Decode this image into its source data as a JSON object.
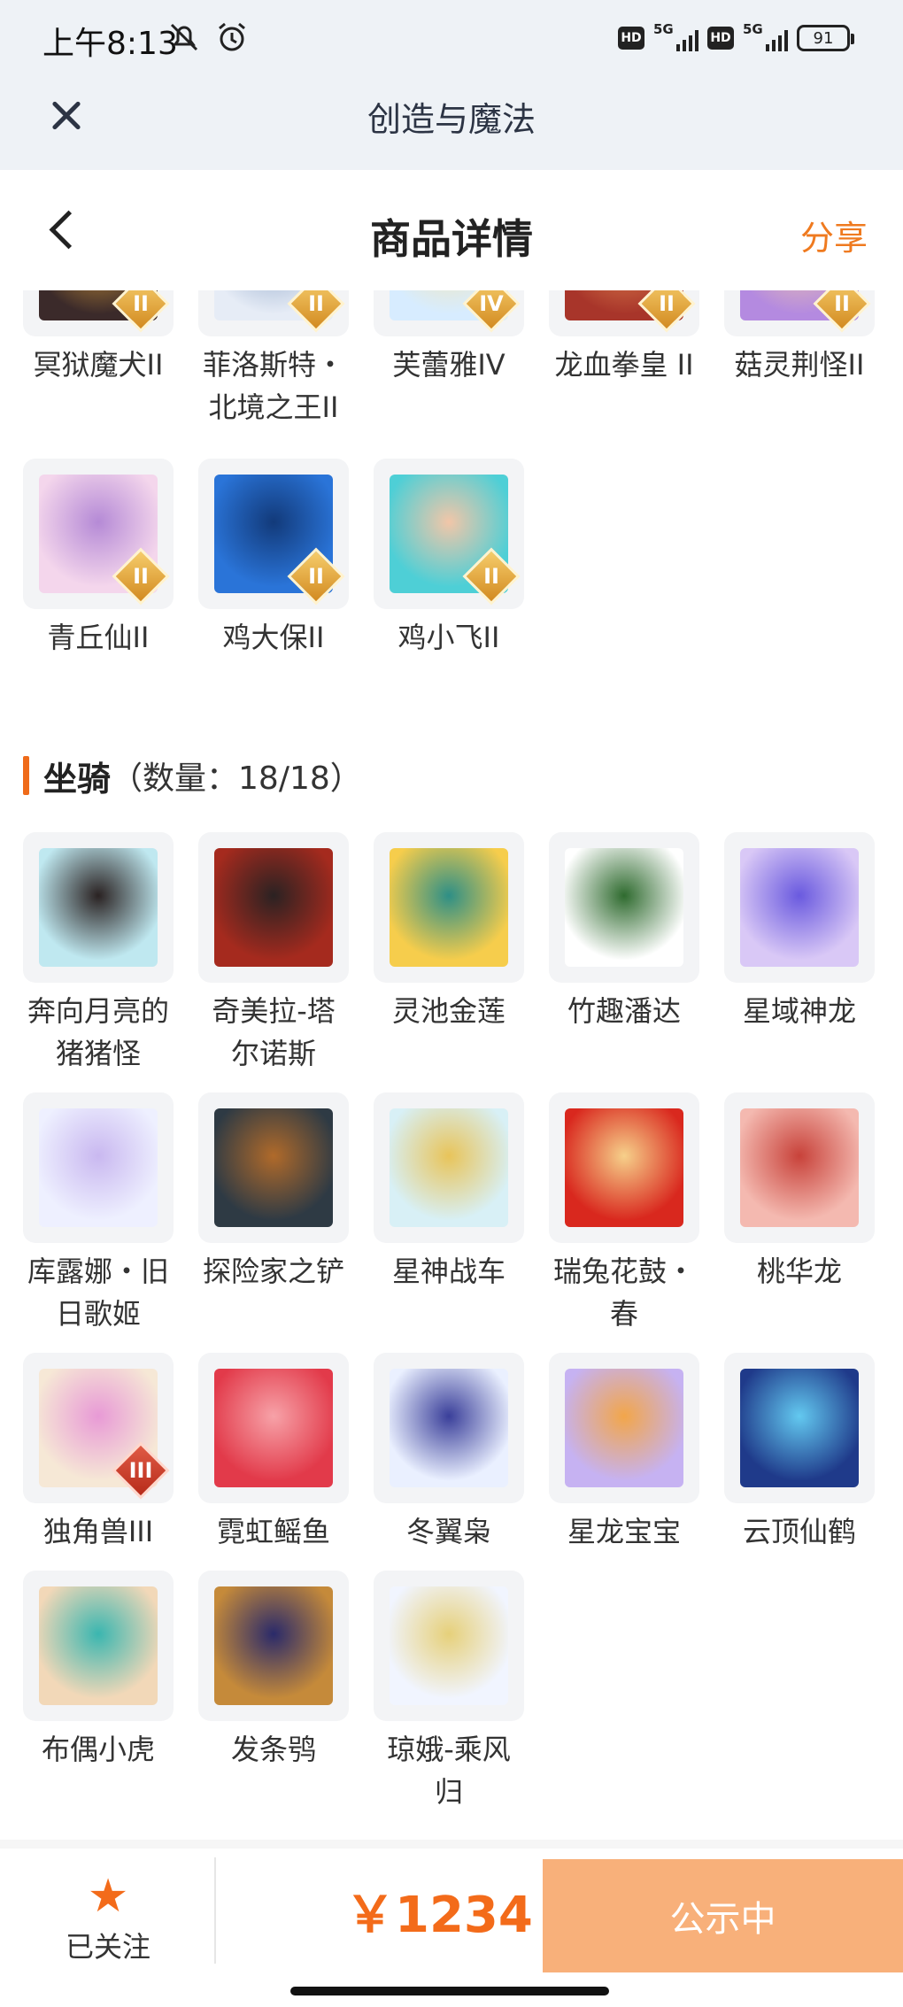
{
  "status_bar": {
    "time": "上午8:13",
    "network1": "5G",
    "network2": "5G",
    "battery": "91"
  },
  "app_bar": {
    "title": "创造与魔法"
  },
  "header": {
    "title": "商品详情",
    "share": "分享"
  },
  "pets_grid": [
    {
      "name": "冥狱魔犬II",
      "tier": "II",
      "colors": [
        "#3b2a2a",
        "#d39a3a"
      ]
    },
    {
      "name": "菲洛斯特・北境之王II",
      "tier": "II",
      "colors": [
        "#e6ecf6",
        "#8fa6c8"
      ]
    },
    {
      "name": "芙蕾雅IV",
      "tier": "IV",
      "colors": [
        "#d7ecff",
        "#f6e6b0"
      ]
    },
    {
      "name": "龙血拳皇 II",
      "tier": "II",
      "colors": [
        "#a8352a",
        "#e38a52"
      ]
    },
    {
      "name": "菇灵荆怪II",
      "tier": "II",
      "colors": [
        "#b48ae0",
        "#f2c9a8"
      ]
    },
    {
      "name": "青丘仙II",
      "tier": "II",
      "colors": [
        "#f4d6ec",
        "#b58ad6"
      ]
    },
    {
      "name": "鸡大保II",
      "tier": "II",
      "colors": [
        "#2a74d8",
        "#123a7a"
      ]
    },
    {
      "name": "鸡小飞II",
      "tier": "II",
      "colors": [
        "#4ecfd6",
        "#f2c6a8"
      ]
    }
  ],
  "mounts_section": {
    "title": "坐骑",
    "count": "（数量：18/18）"
  },
  "mounts_grid": [
    {
      "name": "奔向月亮的猪猪怪",
      "tier": "",
      "colors": [
        "#bfe8f0",
        "#2a2222"
      ]
    },
    {
      "name": "奇美拉-塔尔诺斯",
      "tier": "",
      "colors": [
        "#a52a1e",
        "#2b2222"
      ]
    },
    {
      "name": "灵池金莲",
      "tier": "",
      "colors": [
        "#f6cd4c",
        "#2e8f86"
      ]
    },
    {
      "name": "竹趣潘达",
      "tier": "",
      "colors": [
        "#ffffff",
        "#2f6b2f"
      ]
    },
    {
      "name": "星域神龙",
      "tier": "",
      "colors": [
        "#d9c8f6",
        "#6a5adf"
      ]
    },
    {
      "name": "库露娜・旧日歌姬",
      "tier": "",
      "colors": [
        "#eef0ff",
        "#c9b8f0"
      ]
    },
    {
      "name": "探险家之铲",
      "tier": "",
      "colors": [
        "#2e3a44",
        "#b06a2a"
      ]
    },
    {
      "name": "星神战车",
      "tier": "",
      "colors": [
        "#d8f0f6",
        "#e8c45a"
      ]
    },
    {
      "name": "瑞兔花鼓・春",
      "tier": "",
      "colors": [
        "#d9281e",
        "#f6d08a"
      ]
    },
    {
      "name": "桃华龙",
      "tier": "",
      "colors": [
        "#f4b9b0",
        "#c8423a"
      ]
    },
    {
      "name": "独角兽III",
      "tier": "III",
      "colors": [
        "#f6e8d6",
        "#e89ad6"
      ]
    },
    {
      "name": "霓虹鳐鱼",
      "tier": "",
      "colors": [
        "#e23a4a",
        "#f7a2a8"
      ]
    },
    {
      "name": "冬翼枭",
      "tier": "",
      "colors": [
        "#eaf0ff",
        "#3a3f9a"
      ]
    },
    {
      "name": "星龙宝宝",
      "tier": "",
      "colors": [
        "#c6b2f2",
        "#f2a64a"
      ]
    },
    {
      "name": "云顶仙鹤",
      "tier": "",
      "colors": [
        "#1f3a8a",
        "#63c9f0"
      ]
    },
    {
      "name": "布偶小虎",
      "tier": "",
      "colors": [
        "#f2d8b8",
        "#3ab6b0"
      ]
    },
    {
      "name": "发条鸮",
      "tier": "",
      "colors": [
        "#c58a3a",
        "#2a2a6a"
      ]
    },
    {
      "name": "琼娥-乘风归",
      "tier": "",
      "colors": [
        "#f1f5ff",
        "#e6d07a"
      ]
    }
  ],
  "bottom_bar": {
    "fav_label": "已关注",
    "price": "￥1234",
    "status": "公示中"
  },
  "colors": {
    "accent": "#f36b1a",
    "status_button": "#f8b07a"
  }
}
